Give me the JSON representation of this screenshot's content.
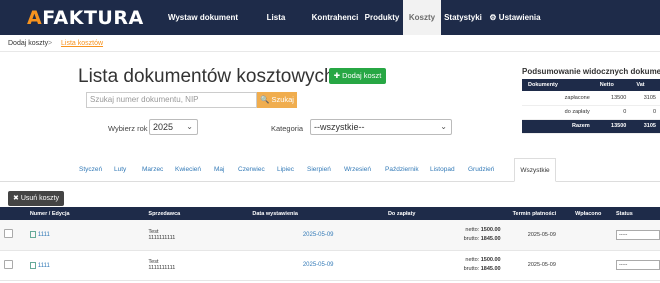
{
  "brand": {
    "first": "A",
    "rest": "FAKTURA"
  },
  "nav": [
    {
      "label": "Wystaw dokument"
    },
    {
      "label": "Lista dokumentów"
    },
    {
      "label": "Kontrahenci"
    },
    {
      "label": "Produkty"
    },
    {
      "label": "Koszty",
      "active": true
    },
    {
      "label": "Statystyki"
    },
    {
      "label": "⚙ Ustawienia"
    }
  ],
  "breadcrumb": {
    "item1": "Dodaj koszty",
    "sep": ">",
    "item2": "Lista kosztów"
  },
  "page": {
    "title": "Lista dokumentów kosztowych",
    "add_label": "✚ Dodaj koszt"
  },
  "search": {
    "placeholder": "Szukaj numer dokumentu, NIP",
    "button": "🔍 Szukaj"
  },
  "filters": {
    "year_label": "Wybierz rok",
    "year_value": "2025",
    "category_label": "Kategoria",
    "category_value": "--wszystkie--"
  },
  "summary": {
    "title": "Podsumowanie widocznych dokumentów",
    "headers": [
      "Dokumenty",
      "Netto",
      "Vat"
    ],
    "rows": [
      {
        "label": "zapłacone",
        "netto": "13500",
        "vat": "3105"
      },
      {
        "label": "do zapłaty",
        "netto": "0",
        "vat": "0"
      }
    ],
    "total": {
      "label": "Razem",
      "netto": "13500",
      "vat": "3105"
    }
  },
  "months": [
    "Styczeń",
    "Luty",
    "Marzec",
    "Kwiecień",
    "Maj",
    "Czerwiec",
    "Lipiec",
    "Sierpień",
    "Wrzesień",
    "Październik",
    "Listopad",
    "Grudzień",
    "Wszystkie"
  ],
  "toolbar": {
    "delete_label": "✖ Usuń koszty"
  },
  "table": {
    "headers": [
      "Numer / Edycja",
      "Sprzedawca",
      "Data wystawienia",
      "Do zapłaty",
      "Termin płatności",
      "Wpłacono",
      "Status"
    ],
    "rows": [
      {
        "number": "1111",
        "seller_name": "Test",
        "seller_nip": "1111111111",
        "issue_date": "2025-05-09",
        "netto_label": "netto:",
        "netto": "1500.00",
        "brutto_label": "brutto:",
        "brutto": "1845.00",
        "due_date": "2025-05-09",
        "paid": "",
        "status": "-----"
      },
      {
        "number": "1111",
        "seller_name": "Test",
        "seller_nip": "1111111111",
        "issue_date": "2025-05-09",
        "netto_label": "netto:",
        "netto": "1500.00",
        "brutto_label": "brutto:",
        "brutto": "1845.00",
        "due_date": "2025-05-09",
        "paid": "",
        "status": "-----"
      }
    ]
  },
  "colors": {
    "navbar": "#1e2b49",
    "accent": "#f7931e",
    "add": "#27a744",
    "search": "#f0ad4e",
    "link": "#337ab7"
  }
}
